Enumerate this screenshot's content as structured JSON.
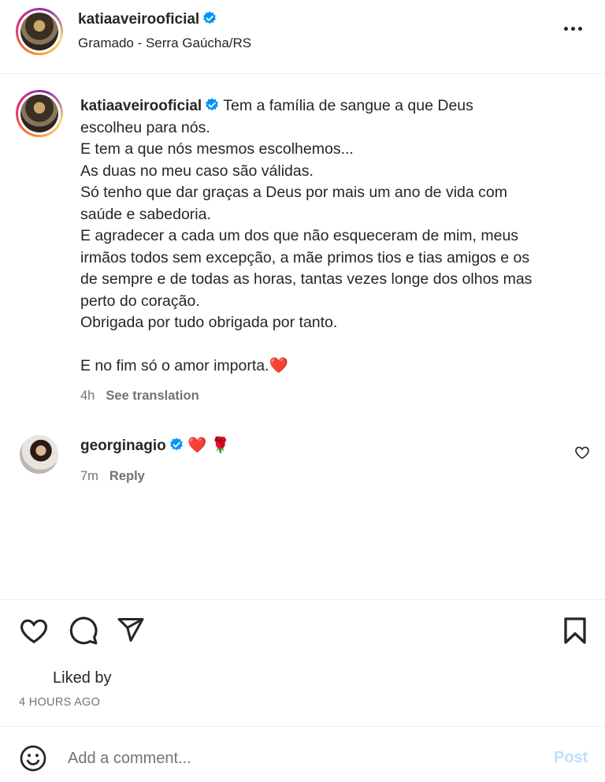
{
  "header": {
    "username": "katiaaveirooficial",
    "location": "Gramado - Serra Gaúcha/RS"
  },
  "caption": {
    "username": "katiaaveirooficial",
    "first_line": "Tem a família de sangue a que Deus",
    "lines": [
      "escolheu para nós.",
      "E tem a que nós mesmos escolhemos...",
      "As duas no meu caso são válidas.",
      "Só tenho que dar graças a Deus por mais um ano de vida com",
      "saúde e sabedoria.",
      "E agradecer a cada um dos que não esqueceram de mim, meus",
      "irmãos todos sem excepção, a mãe primos tios e tias amigos e os",
      "de sempre e de todas as horas, tantas vezes longe dos olhos mas",
      "perto do coração.",
      "Obrigada por tudo obrigada por tanto.",
      "",
      "E no fim só o amor importa.❤️"
    ],
    "time": "4h",
    "see_translation": "See translation"
  },
  "comment": {
    "username": "georginagio",
    "text": "❤️ 🌹",
    "time": "7m",
    "reply": "Reply"
  },
  "footer": {
    "liked_by": "Liked by",
    "time_ago": "4 HOURS AGO",
    "comment_placeholder": "Add a comment...",
    "post_label": "Post"
  },
  "colors": {
    "verified": "#0095f6",
    "text": "#262626",
    "secondary": "#737373",
    "post_disabled": "#c0dffd",
    "heart_emoji": "#e0245e"
  },
  "icons": [
    "more-icon",
    "verified-icon",
    "heart-icon",
    "comment-icon",
    "share-icon",
    "bookmark-icon",
    "emoji-icon"
  ]
}
